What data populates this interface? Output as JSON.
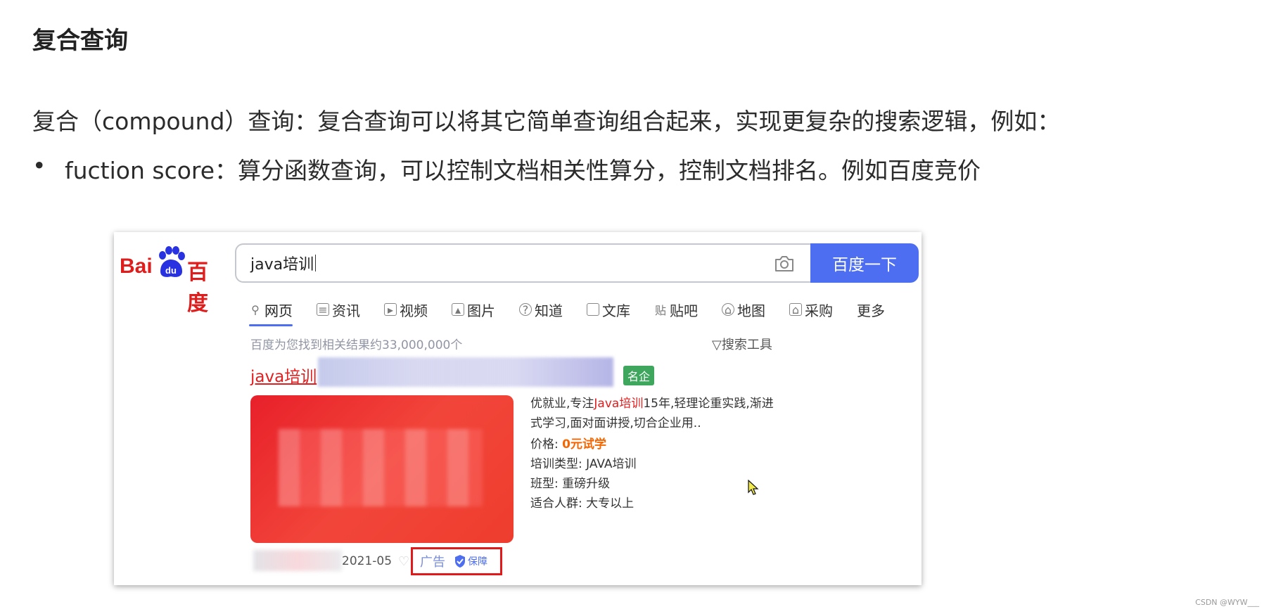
{
  "slide": {
    "title": "复合查询",
    "paragraph": "复合（compound）查询：复合查询可以将其它简单查询组合起来，实现更复杂的搜索逻辑，例如：",
    "bullet": "fuction score：算分函数查询，可以控制文档相关性算分，控制文档排名。例如百度竞价"
  },
  "baidu": {
    "logo": {
      "latin": "Bai",
      "paw": "du",
      "cn": "百度"
    },
    "search": {
      "value": "java培训",
      "button": "百度一下"
    },
    "tabs": [
      {
        "label": "网页",
        "icon": "search-icon"
      },
      {
        "label": "资讯",
        "icon": "news-icon"
      },
      {
        "label": "视频",
        "icon": "video-icon"
      },
      {
        "label": "图片",
        "icon": "image-icon"
      },
      {
        "label": "知道",
        "icon": "question-icon"
      },
      {
        "label": "文库",
        "icon": "doc-icon"
      },
      {
        "label": "贴吧",
        "icon": "tieba-icon"
      },
      {
        "label": "地图",
        "icon": "map-icon"
      },
      {
        "label": "采购",
        "icon": "bag-icon"
      },
      {
        "label": "更多",
        "icon": ""
      }
    ],
    "result_count": "百度为您找到相关结果约33,000,000个",
    "search_tools": "搜索工具",
    "ad": {
      "title": "java培训",
      "badge": "名企",
      "desc_pre": "优就业,专注",
      "desc_hl": "Java培训",
      "desc_post": "15年,轻理论重实践,渐进",
      "desc_line2": "式学习,面对面讲授,切合企业用..",
      "price_label": "价格:",
      "price_value": "0元试学",
      "type_line": "培训类型:  JAVA培训",
      "class_line": "班型:  重磅升级",
      "audience_line": "适合人群:  大专以上",
      "date": "2021-05",
      "ad_label": "广告",
      "guarantee": "保障"
    }
  },
  "watermark": "CSDN @WYW___",
  "colors": {
    "baidu_blue": "#4e6ef2",
    "ad_red": "#e02020",
    "badge_green": "#3fa65e",
    "price_orange": "#f56600"
  }
}
